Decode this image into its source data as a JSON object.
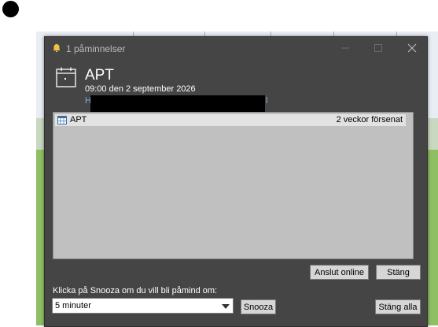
{
  "window": {
    "title": "1 påminnelser"
  },
  "reminder": {
    "title": "APT",
    "datetime": "09:00 den 2 september 2026",
    "location_visible_start": "H",
    "location_visible_end": "l"
  },
  "list": {
    "items": [
      {
        "name": "APT",
        "due": "2 veckor försenat"
      }
    ]
  },
  "buttons": {
    "join_online": "Anslut online",
    "dismiss": "Stäng",
    "snooze": "Snooza",
    "dismiss_all": "Stäng alla"
  },
  "snooze": {
    "prompt": "Klicka på Snooza om du vill bli påmind om:",
    "selected": "5 minuter"
  },
  "colors": {
    "dialog_bg": "#454545",
    "list_bg": "#c0c0c0",
    "row_bg": "#e2e2e2",
    "location_link": "#7db4e8",
    "bell": "#f0c24b"
  },
  "icons": [
    "bell-icon",
    "minimize-icon",
    "maximize-icon",
    "close-icon",
    "calendar-icon",
    "calendar-item-icon",
    "dropdown-arrow-icon"
  ]
}
